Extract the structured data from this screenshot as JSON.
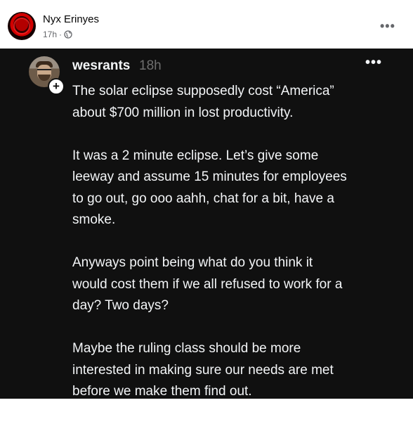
{
  "post": {
    "author": "Nyx Erinyes",
    "time": "17h",
    "separator": "·",
    "privacy_icon": "globe-icon",
    "more_label": "•••"
  },
  "threads": {
    "username": "wesrants",
    "time": "18h",
    "more_label": "•••",
    "follow_icon": "plus-icon",
    "paragraphs": [
      [
        "The solar eclipse supposedly cost “America”",
        "about $700 million in lost productivity."
      ],
      [
        "It was a 2 minute eclipse. Let’s give some",
        "leeway and assume 15 minutes for employees",
        "to go out, go ooo aahh, chat for a bit, have a",
        "smoke."
      ],
      [
        "Anyways point being what do you think it",
        "would cost them if we all refused to work for a",
        "day? Two days?"
      ],
      [
        "Maybe the ruling class should be more",
        "interested in making sure our needs are met",
        "before we make them find out."
      ]
    ]
  },
  "colors": {
    "dark_bg": "#101010",
    "text_light": "#f3f5f7",
    "muted": "#6e6e6e"
  }
}
